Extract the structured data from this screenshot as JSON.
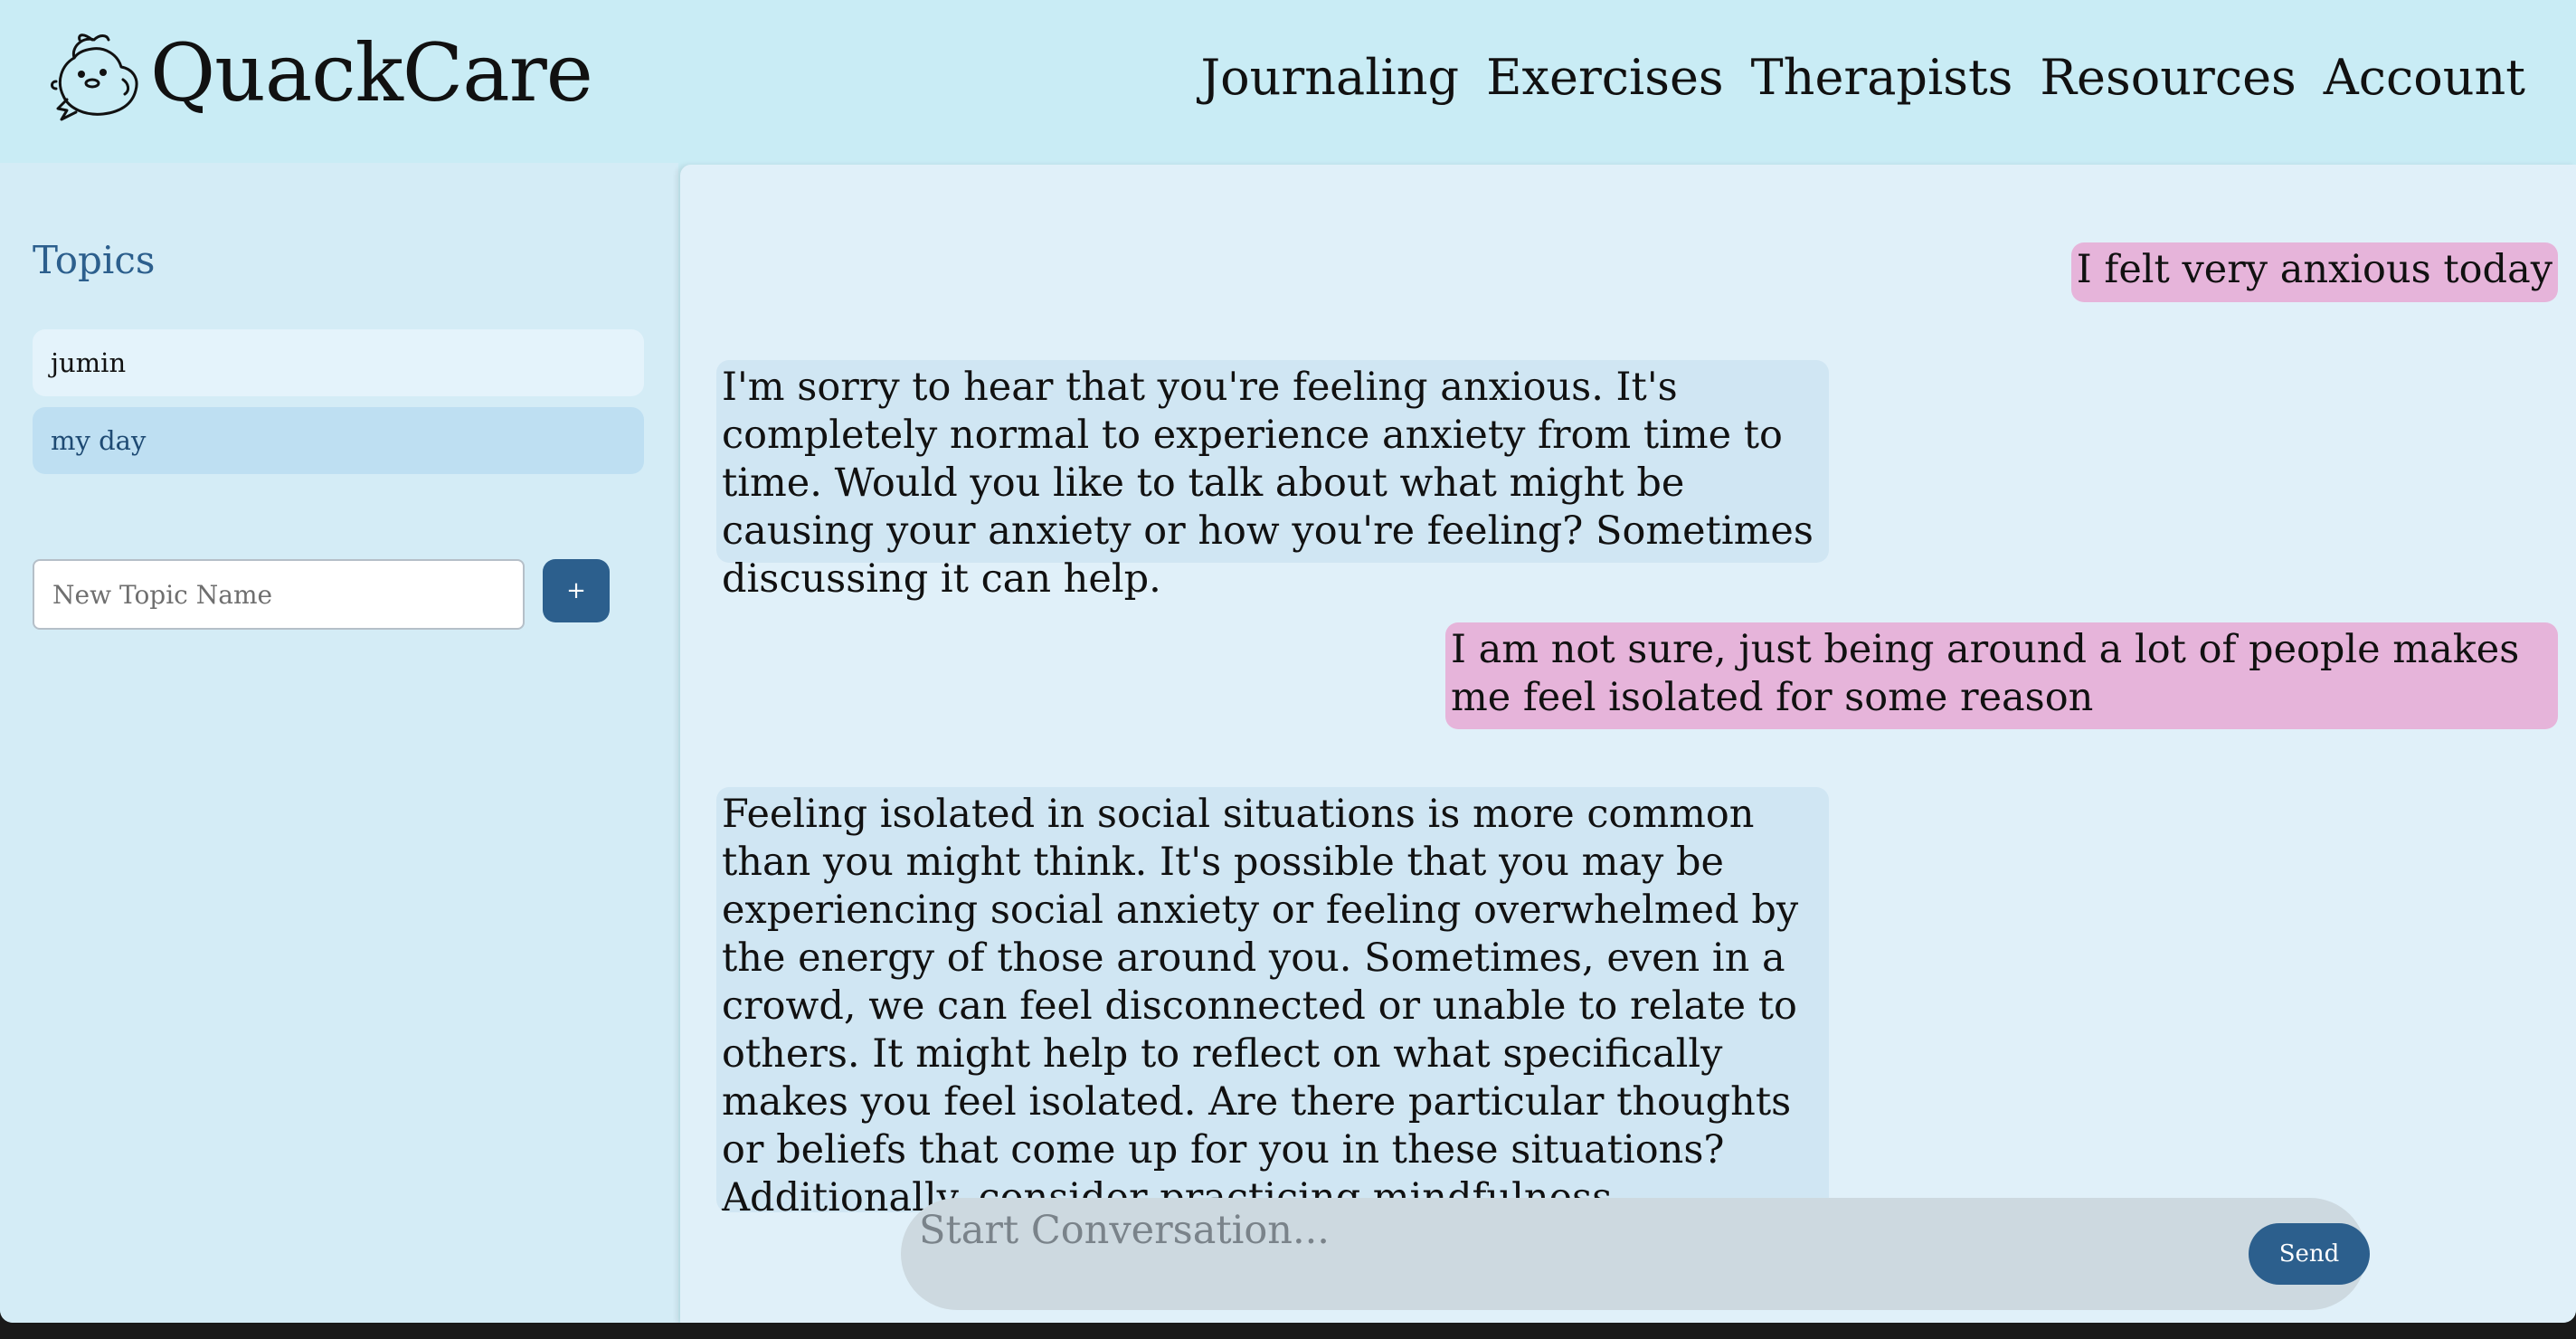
{
  "app": {
    "brand": "QuackCare",
    "logo_icon": "duck-icon"
  },
  "nav": {
    "items": [
      {
        "label": "Journaling"
      },
      {
        "label": "Exercises"
      },
      {
        "label": "Therapists"
      },
      {
        "label": "Resources"
      },
      {
        "label": "Account"
      }
    ]
  },
  "sidebar": {
    "title": "Topics",
    "topics": [
      {
        "label": "jumin",
        "selected": false
      },
      {
        "label": "my day",
        "selected": true
      }
    ],
    "new_topic": {
      "placeholder": "New Topic Name",
      "value": ""
    },
    "add_button": "+"
  },
  "chat": {
    "messages": [
      {
        "role": "user",
        "text": "I felt very anxious today"
      },
      {
        "role": "assistant",
        "text": "I'm sorry to hear that you're feeling anxious. It's completely normal to experience anxiety from time to time. Would you like to talk about what might be causing your anxiety or how you're feeling? Sometimes discussing it can help."
      },
      {
        "role": "user",
        "text": "I am not sure, just being around a lot of people makes me feel isolated for some reason"
      },
      {
        "role": "assistant",
        "text": "Feeling isolated in social situations is more common than you might think. It's possible that you may be experiencing social anxiety or feeling overwhelmed by the energy of those around you. Sometimes, even in a crowd, we can feel disconnected or unable to relate to others. It might help to reflect on what specifically makes you feel isolated. Are there particular thoughts or beliefs that come up for you in these situations? Additionally, consider practicing mindfulness techniques to ground yourself in the moment or find small ways to connect"
      }
    ]
  },
  "composer": {
    "placeholder": "Start Conversation...",
    "value": "",
    "send_label": "Send"
  },
  "colors": {
    "header_bg": "#c9ecf5",
    "sidebar_bg": "#d4ecf6",
    "chat_bg": "#e0f0f9",
    "accent": "#2c5f8d",
    "user_bubble": "#e6b4da",
    "assistant_bubble": "#d0e6f3"
  }
}
